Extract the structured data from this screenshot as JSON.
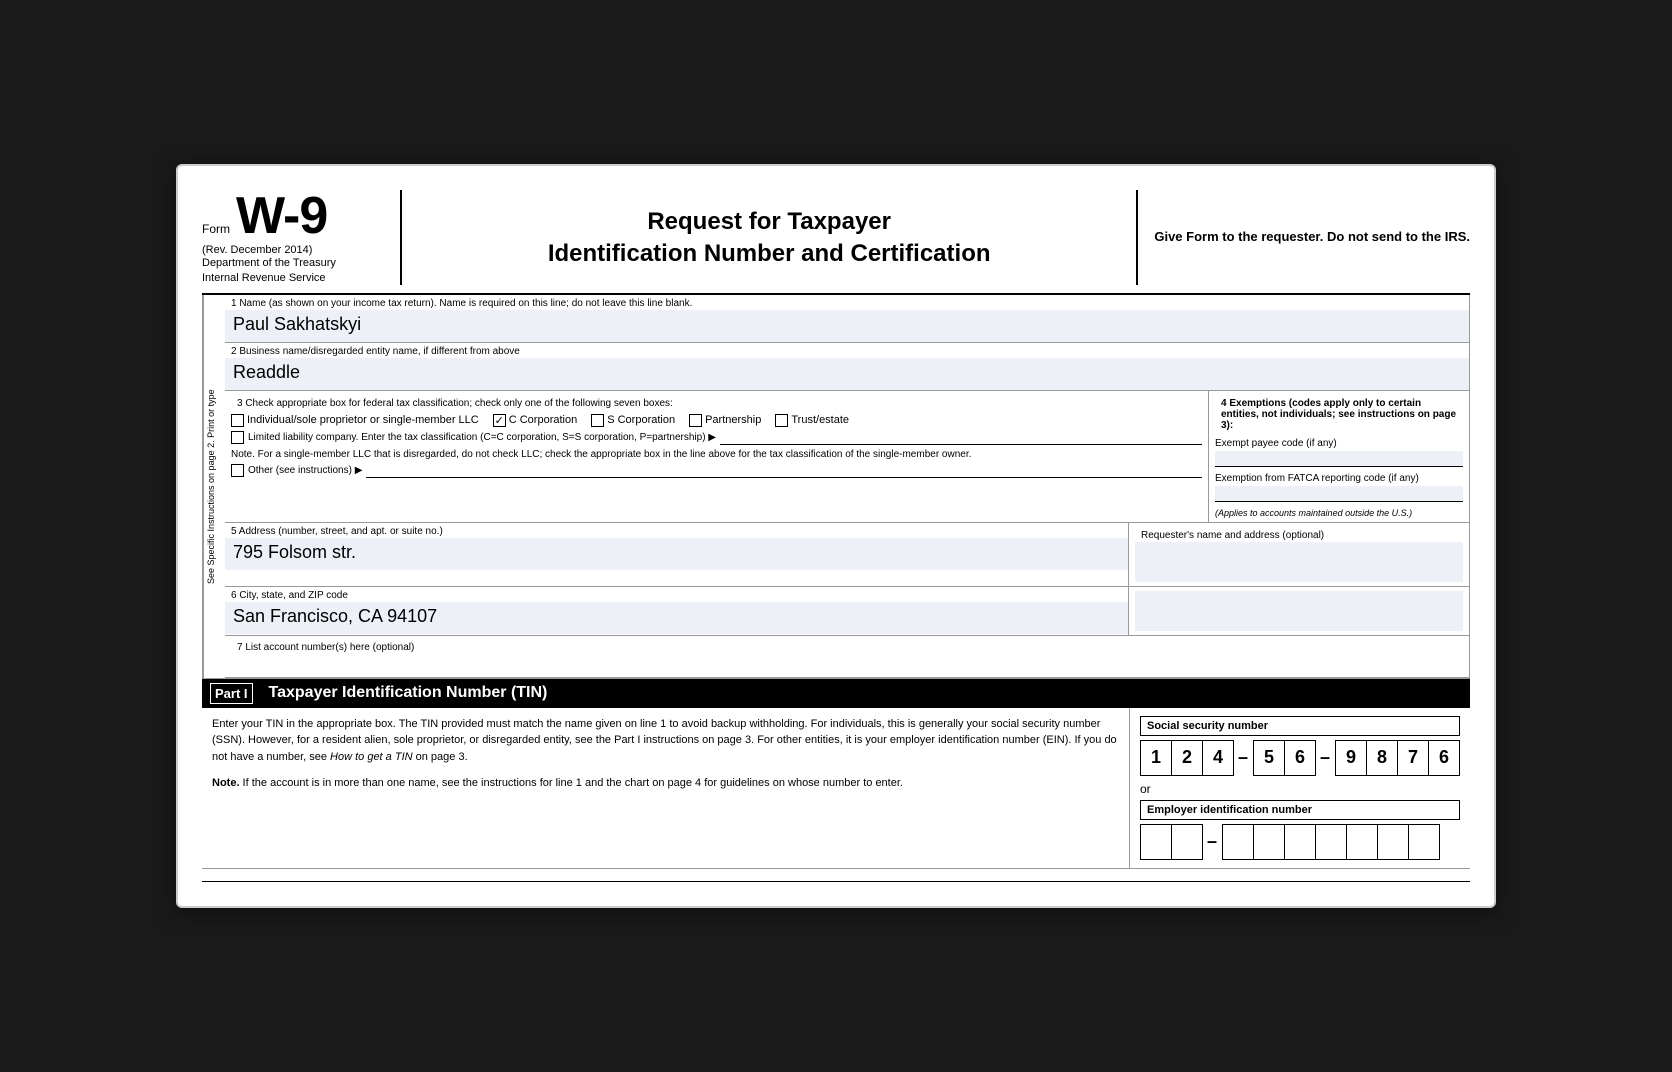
{
  "header": {
    "form_label": "Form",
    "form_number": "W-9",
    "rev": "(Rev. December 2014)",
    "dept1": "Department of the Treasury",
    "dept2": "Internal Revenue Service",
    "title_line1": "Request for Taxpayer",
    "title_line2": "Identification Number and Certification",
    "instruction": "Give Form to the requester. Do not send to the IRS."
  },
  "fields": {
    "field1_label": "1  Name (as shown on your income tax return). Name is required on this line; do not leave this line blank.",
    "field1_value": "Paul Sakhatskyi",
    "field2_label": "2  Business name/disregarded entity name, if different from above",
    "field2_value": "Readdle",
    "field3_label": "3  Check appropriate box for federal tax classification; check only one of the following seven boxes:",
    "checkbox_individual": "Individual/sole proprietor or single-member LLC",
    "checkbox_c_corp": "C Corporation",
    "checkbox_s_corp": "S Corporation",
    "checkbox_partnership": "Partnership",
    "checkbox_trust": "Trust/estate",
    "llc_label": "Limited liability company. Enter the tax classification (C=C corporation, S=S corporation, P=partnership) ▶",
    "note_text": "Note. For a single-member LLC that is disregarded, do not check LLC; check the appropriate box in the line above for the tax classification of the single-member owner.",
    "other_label": "Other (see instructions) ▶",
    "field4_label": "4  Exemptions (codes apply only to certain entities, not individuals; see instructions on page 3):",
    "exempt_payee_label": "Exempt payee code (if any)",
    "fatca_label": "Exemption from FATCA reporting code (if any)",
    "fatca_note": "(Applies to accounts maintained outside the U.S.)",
    "field5_label": "5  Address (number, street, and apt. or suite no.)",
    "field5_value": "795 Folsom str.",
    "requester_label": "Requester's name and address (optional)",
    "field6_label": "6  City, state, and ZIP code",
    "field6_value": "San Francisco, CA 94107",
    "field7_label": "7  List account number(s) here (optional)",
    "side_label": "See Specific Instructions on page 2.   Print or type"
  },
  "part1": {
    "label": "Part I",
    "title": "Taxpayer Identification Number (TIN)",
    "description": "Enter your TIN in the appropriate box. The TIN provided must match the name given on line 1 to avoid backup withholding. For individuals, this is generally your social security number (SSN). However, for a resident alien, sole proprietor, or disregarded entity, see the Part I instructions on page 3. For other entities, it is your employer identification number (EIN). If you do not have a number, see How to get a TIN on page 3.",
    "note": "Note. If the account is in more than one name, see the instructions for line 1 and the chart on page 4 for guidelines on whose number to enter.",
    "ssn_label": "Social security number",
    "ssn_digits": [
      "1",
      "2",
      "4",
      "",
      "5",
      "6",
      "",
      "9",
      "8",
      "7",
      "6"
    ],
    "ssn_groups": [
      [
        "1",
        "2",
        "4"
      ],
      [
        "5",
        "6"
      ],
      [
        "9",
        "8",
        "7",
        "6"
      ]
    ],
    "or_text": "or",
    "ein_label": "Employer identification number",
    "ein_boxes": [
      "",
      "",
      "",
      "",
      "",
      "",
      "",
      "",
      ""
    ]
  }
}
